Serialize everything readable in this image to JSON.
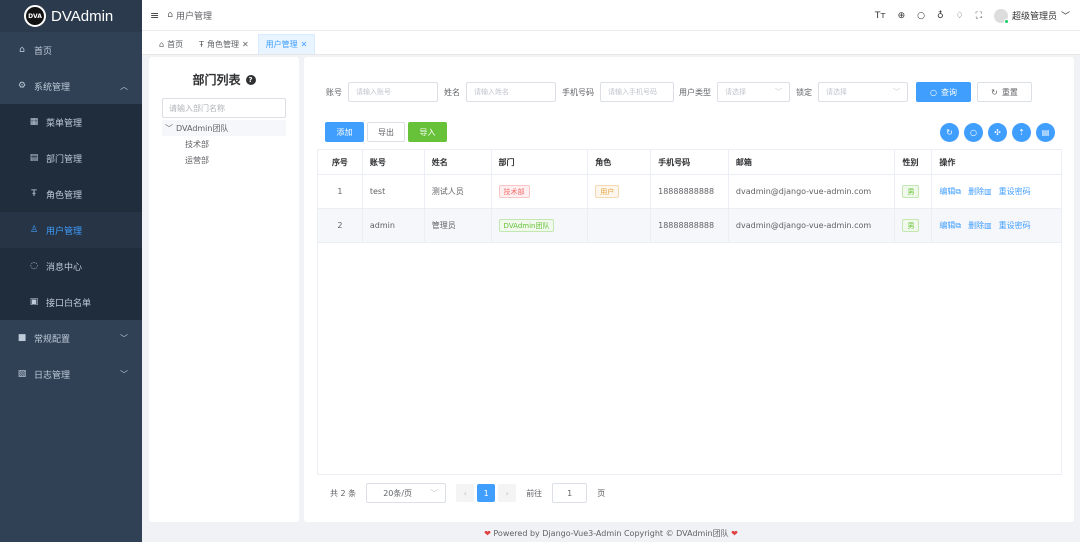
{
  "app": {
    "logo_mark": "DVA",
    "name": "DVAdmin"
  },
  "sidebar": {
    "items": [
      {
        "label": "首页",
        "icon": "home-icon"
      },
      {
        "label": "系统管理",
        "icon": "gear-icon"
      },
      {
        "label": "菜单管理",
        "icon": "grid-icon"
      },
      {
        "label": "部门管理",
        "icon": "building-icon"
      },
      {
        "label": "角色管理",
        "icon": "role-icon"
      },
      {
        "label": "用户管理",
        "icon": "user-icon"
      },
      {
        "label": "消息中心",
        "icon": "message-icon"
      },
      {
        "label": "接口白名单",
        "icon": "list-icon"
      },
      {
        "label": "常规配置",
        "icon": "config-icon"
      },
      {
        "label": "日志管理",
        "icon": "log-icon"
      }
    ]
  },
  "header": {
    "breadcrumb": "用户管理",
    "username": "超级管理员"
  },
  "tabs": [
    {
      "label": "首页"
    },
    {
      "label": "角色管理"
    },
    {
      "label": "用户管理"
    }
  ],
  "dept_panel": {
    "title": "部门列表",
    "search_placeholder": "请输入部门名称",
    "root": "DVAdmin团队",
    "children": [
      "技术部",
      "运营部"
    ]
  },
  "filters": {
    "account_label": "账号",
    "account_placeholder": "请输入账号",
    "name_label": "姓名",
    "name_placeholder": "请输入姓名",
    "phone_label": "手机号码",
    "phone_placeholder": "请输入手机号码",
    "type_label": "用户类型",
    "type_placeholder": "请选择",
    "lock_label": "锁定",
    "lock_placeholder": "请选择",
    "search_btn": "查询",
    "reset_btn": "重置"
  },
  "actions": {
    "add": "添加",
    "export": "导出",
    "import": "导入"
  },
  "table": {
    "headers": [
      "序号",
      "账号",
      "姓名",
      "部门",
      "角色",
      "手机号码",
      "邮箱",
      "性别",
      "操作"
    ],
    "rows": [
      {
        "index": "1",
        "account": "test",
        "name": "测试人员",
        "dept": "技术部",
        "role": "用户",
        "phone": "18888888888",
        "email": "dvadmin@django-vue-admin.com",
        "gender": "男"
      },
      {
        "index": "2",
        "account": "admin",
        "name": "管理员",
        "dept": "DVAdmin团队",
        "role": "",
        "phone": "18888888888",
        "email": "dvadmin@django-vue-admin.com",
        "gender": "男"
      }
    ],
    "ops": {
      "edit": "编辑",
      "delete": "删除",
      "reset_pwd": "重设密码"
    }
  },
  "pagination": {
    "total": "共 2 条",
    "page_size": "20条/页",
    "current": "1",
    "goto_label": "前往",
    "goto_value": "1",
    "page_unit": "页"
  },
  "footer": {
    "text": "Powered by Django-Vue3-Admin Copyright © DVAdmin团队"
  }
}
